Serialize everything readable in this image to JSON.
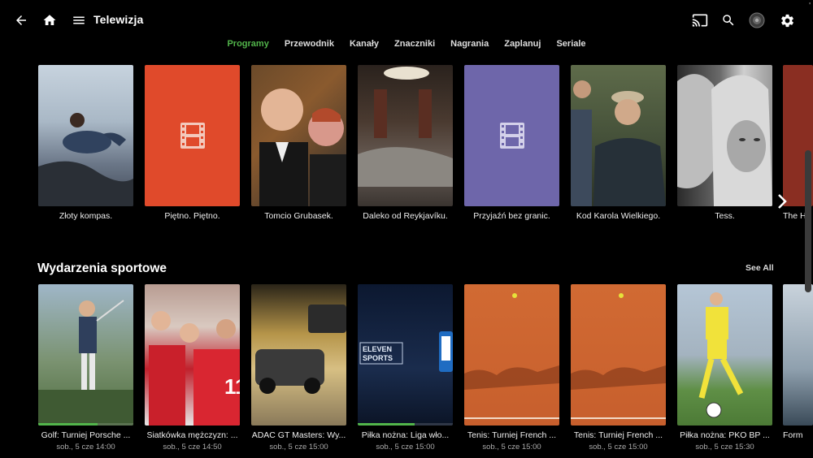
{
  "header": {
    "title": "Telewizja",
    "corner_mark": "'",
    "icons": [
      "back-arrow-icon",
      "home-icon",
      "menu-icon",
      "cast-icon",
      "search-icon",
      "user-avatar",
      "gear-icon"
    ]
  },
  "tabs": [
    {
      "label": "Programy",
      "active": true
    },
    {
      "label": "Przewodnik",
      "active": false
    },
    {
      "label": "Kanały",
      "active": false
    },
    {
      "label": "Znaczniki",
      "active": false
    },
    {
      "label": "Nagrania",
      "active": false
    },
    {
      "label": "Zaplanuj",
      "active": false
    },
    {
      "label": "Seriale",
      "active": false
    }
  ],
  "movies": [
    {
      "title": "Złoty kompas."
    },
    {
      "title": "Piętno. Piętno."
    },
    {
      "title": "Tomcio Grubasek."
    },
    {
      "title": "Daleko od Reykjavíku."
    },
    {
      "title": "Przyjaźń bez granic."
    },
    {
      "title": "Kod Karola Wielkiego."
    },
    {
      "title": "Tess."
    },
    {
      "title": "The H"
    }
  ],
  "sports": {
    "section_title": "Wydarzenia sportowe",
    "see_all": "See All",
    "items": [
      {
        "title": "Golf: Turniej Porsche ...",
        "time": "sob., 5 cze 14:00",
        "progress": 0.62
      },
      {
        "title": "Siatkówka mężczyzn: ...",
        "time": "sob., 5 cze 14:50",
        "progress": 0.0
      },
      {
        "title": "ADAC GT Masters: Wy...",
        "time": "sob., 5 cze 15:00",
        "progress": 0.0
      },
      {
        "title": "Piłka nożna: Liga wło...",
        "time": "sob., 5 cze 15:00",
        "progress": 0.6
      },
      {
        "title": "Tenis: Turniej French ...",
        "time": "sob., 5 cze 15:00",
        "progress": 0.0
      },
      {
        "title": "Tenis: Turniej French ...",
        "time": "sob., 5 cze 15:00",
        "progress": 0.0
      },
      {
        "title": "Piłka nożna: PKO BP ...",
        "time": "sob., 5 cze 15:30",
        "progress": 0.0
      },
      {
        "title": "Form"
      }
    ]
  },
  "colors": {
    "accent": "#52b54b",
    "placeholder_red": "#e04a2b",
    "placeholder_purple": "#6e66aa"
  }
}
